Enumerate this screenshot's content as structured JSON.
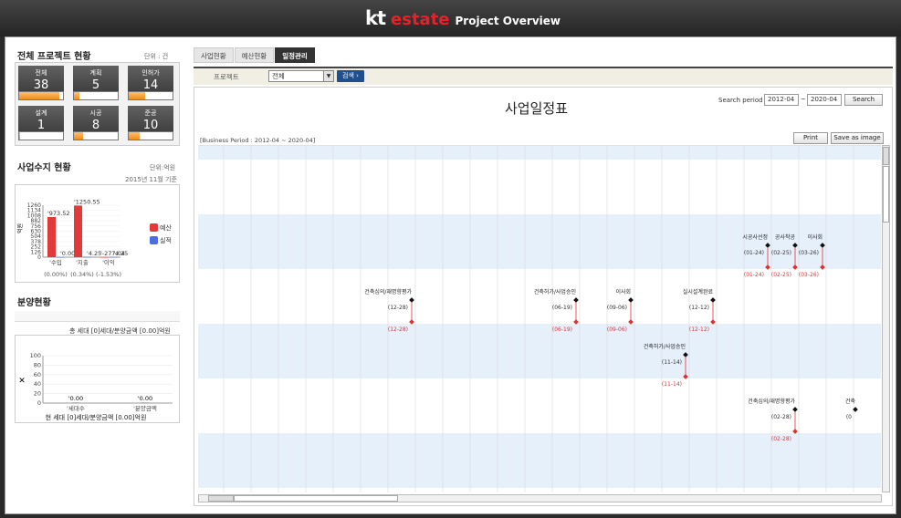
{
  "header": {
    "logo_kt": "kt",
    "logo_estate": "estate",
    "title": "Project Overview"
  },
  "overview": {
    "title": "전체 프로젝트 현황",
    "unit": "단위 : 건",
    "cards": [
      {
        "label": "전체",
        "value": "38",
        "fill": 0.92
      },
      {
        "label": "계획",
        "value": "5",
        "fill": 0.13
      },
      {
        "label": "인허가",
        "value": "14",
        "fill": 0.37
      },
      {
        "label": "설계",
        "value": "1",
        "fill": 0.03
      },
      {
        "label": "시공",
        "value": "8",
        "fill": 0.21
      },
      {
        "label": "준공",
        "value": "10",
        "fill": 0.26
      }
    ]
  },
  "budget": {
    "title": "사업수지 현황",
    "unit": "단위:억원",
    "date": "2015년 11월 기준",
    "chart_data": {
      "type": "bar",
      "categories": [
        "수입",
        "지출",
        "이익"
      ],
      "series": [
        {
          "name": "예산",
          "values": [
            973.52,
            1250.55,
            -277.04
          ]
        },
        {
          "name": "실적",
          "values": [
            0.0,
            4.25,
            4.25
          ]
        }
      ],
      "ylabel": "억원",
      "yticks": [
        "1260",
        "1134",
        "1008",
        "882",
        "756",
        "630",
        "504",
        "378",
        "252",
        "126",
        "0"
      ],
      "ylim": [
        0,
        1260
      ],
      "legend": "right",
      "value_labels": [
        "'973.52",
        "'0.00",
        "'1250.55",
        "'4.25",
        "'-277.04",
        "'4.25"
      ],
      "x_labels": [
        "'수입",
        "'지출",
        "'이익"
      ],
      "rates": [
        "(0.00%)",
        "(0.34%)",
        "(-1.53%)"
      ]
    }
  },
  "sales": {
    "title": "분양현황",
    "summary": "총 세대 [0]세대/분양금액 [0.00]억원",
    "footer": "현 세대 [0]세대/분양금액 [0.00]억원",
    "chart_data": {
      "type": "bar",
      "categories": [
        "세대수",
        "분양금액"
      ],
      "values": [
        0.0,
        0.0
      ],
      "yticks": [
        "100",
        "80",
        "60",
        "40",
        "20",
        "0"
      ],
      "ylim": [
        0,
        100
      ],
      "value_labels": [
        "'0.00",
        "'0.00"
      ],
      "x_labels": [
        "'세대수",
        "'분양금액"
      ]
    }
  },
  "tabs": [
    "사업현황",
    "예산현황",
    "일정관리"
  ],
  "filter": {
    "label": "프로젝트",
    "value": "전체",
    "search": "검색 ›"
  },
  "schedule": {
    "title": "사업일정표",
    "period_label": "Search period",
    "from": "2012-04",
    "sep": "~",
    "to": "2020-04",
    "search": "Search",
    "business_period": "[Business Period : 2012-04 ~ 2020-04]",
    "print": "Print",
    "save": "Save as image",
    "milestones": [
      {
        "row": 2,
        "col": 21,
        "label": "시공사선정",
        "plan": "(01-24)",
        "actual": "(01-24)"
      },
      {
        "row": 2,
        "col": 22,
        "label": "공사착공",
        "plan": "(02-25)",
        "actual": "(02-25)"
      },
      {
        "row": 2,
        "col": 23,
        "label": "이사회",
        "plan": "(03-26)",
        "actual": "(03-26)"
      },
      {
        "row": 3,
        "col": 8,
        "label": "건축심의/재명향평가",
        "plan": "(12-28)",
        "actual": "(12-28)"
      },
      {
        "row": 3,
        "col": 14,
        "label": "건축허가/사업승인",
        "plan": "(06-19)",
        "actual": "(06-19)"
      },
      {
        "row": 3,
        "col": 16,
        "label": "이사회",
        "plan": "(09-06)",
        "actual": "(09-06)"
      },
      {
        "row": 3,
        "col": 19,
        "label": "실시설계완료",
        "plan": "(12-12)",
        "actual": "(12-12)"
      },
      {
        "row": 4,
        "col": 18,
        "label": "건축허가/사업승인",
        "plan": "(11-14)",
        "actual": "(11-14)"
      },
      {
        "row": 5,
        "col": 22,
        "label": "건축심의/재명향평가",
        "plan": "(02-28)",
        "actual": "(02-28)"
      },
      {
        "row": 5,
        "col": 24,
        "label": "건축",
        "plan": "(0",
        "actual": ""
      }
    ]
  }
}
